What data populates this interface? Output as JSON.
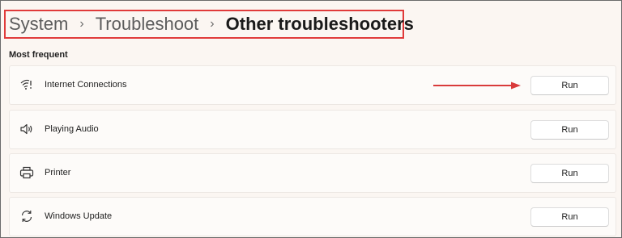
{
  "breadcrumb": {
    "items": [
      "System",
      "Troubleshoot",
      "Other troubleshooters"
    ],
    "separator": "›"
  },
  "section": {
    "title": "Most frequent"
  },
  "troubleshooters": [
    {
      "label": "Internet Connections",
      "icon": "wifi-icon",
      "button": "Run"
    },
    {
      "label": "Playing Audio",
      "icon": "speaker-icon",
      "button": "Run"
    },
    {
      "label": "Printer",
      "icon": "printer-icon",
      "button": "Run"
    },
    {
      "label": "Windows Update",
      "icon": "refresh-icon",
      "button": "Run"
    }
  ],
  "colors": {
    "highlight_border": "#e03a3a",
    "arrow": "#d93b3b",
    "background": "#fbf6f2"
  }
}
